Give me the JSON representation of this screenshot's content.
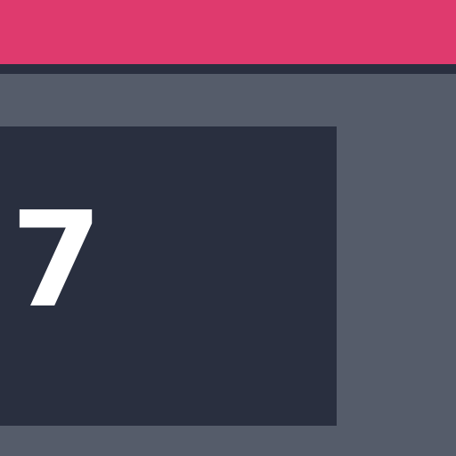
{
  "colors": {
    "accent": "#df3a6e",
    "background": "#555c6a",
    "panel": "#292f3f",
    "text": "#ffffff"
  },
  "header": {
    "bar": "accent-bar"
  },
  "main": {
    "value": "7"
  }
}
